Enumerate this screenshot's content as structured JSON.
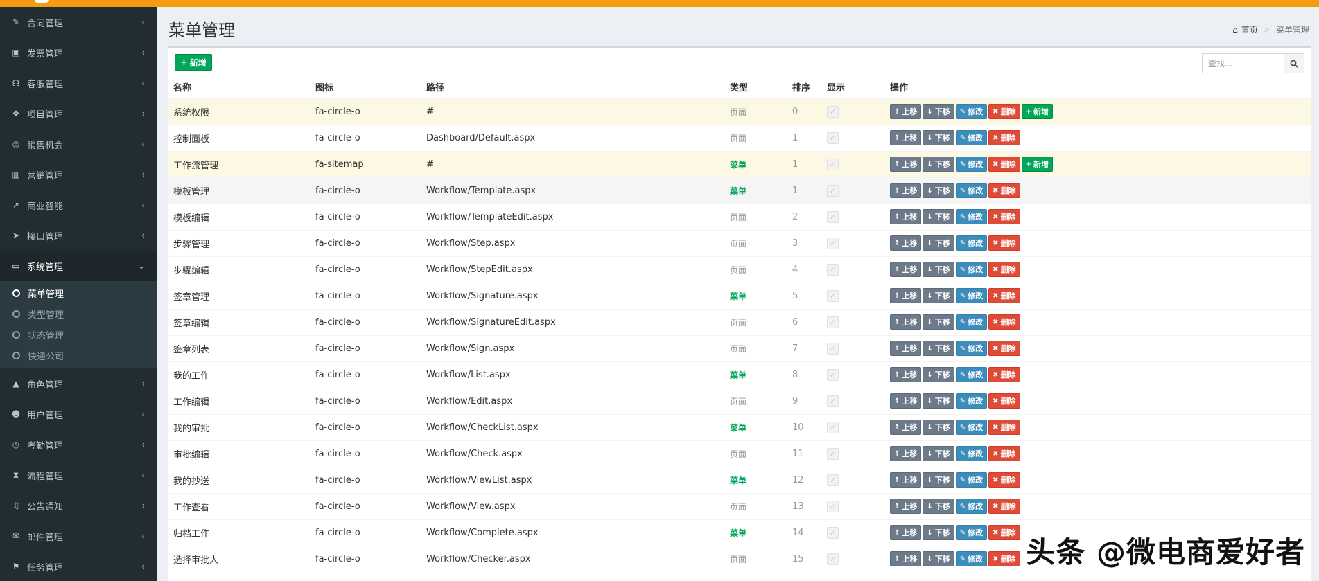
{
  "sidebar": {
    "items": [
      {
        "label": "合同管理",
        "icon": "pencil-icon"
      },
      {
        "label": "发票管理",
        "icon": "money-icon"
      },
      {
        "label": "客服管理",
        "icon": "headset-icon"
      },
      {
        "label": "项目管理",
        "icon": "cubes-icon"
      },
      {
        "label": "销售机会",
        "icon": "binoculars-icon"
      },
      {
        "label": "营销管理",
        "icon": "bar-chart-icon"
      },
      {
        "label": "商业智能",
        "icon": "line-chart-icon"
      },
      {
        "label": "接口管理",
        "icon": "paper-plane-icon"
      },
      {
        "label": "系统管理",
        "icon": "desktop-icon",
        "expanded": true
      },
      {
        "label": "角色管理",
        "icon": "graduation-cap-icon"
      },
      {
        "label": "用户管理",
        "icon": "users-icon"
      },
      {
        "label": "考勤管理",
        "icon": "clock-icon"
      },
      {
        "label": "流程管理",
        "icon": "hourglass-icon"
      },
      {
        "label": "公告通知",
        "icon": "bell-icon"
      },
      {
        "label": "邮件管理",
        "icon": "envelope-icon"
      },
      {
        "label": "任务管理",
        "icon": "flag-icon"
      }
    ],
    "submenu": [
      {
        "label": "菜单管理",
        "current": true
      },
      {
        "label": "类型管理"
      },
      {
        "label": "状态管理"
      },
      {
        "label": "快递公司"
      }
    ]
  },
  "header": {
    "title": "菜单管理",
    "breadcrumb_home": "首页",
    "breadcrumb_sep": ">",
    "breadcrumb_current": "菜单管理"
  },
  "toolbar": {
    "add_label": "新增",
    "search_placeholder": "查找..."
  },
  "table": {
    "columns": [
      "名称",
      "图标",
      "路径",
      "类型",
      "排序",
      "显示",
      "操作"
    ],
    "actions": {
      "up": "上移",
      "down": "下移",
      "edit": "修改",
      "delete": "删除",
      "add": "新增"
    },
    "rows": [
      {
        "name": "系统权限",
        "icon": "fa-circle-o",
        "path": "#",
        "type": "页面",
        "type_kind": "plain",
        "order": "0",
        "has_add": true,
        "style": "warning"
      },
      {
        "name": "控制面板",
        "icon": "fa-circle-o",
        "path": "Dashboard/Default.aspx",
        "type": "页面",
        "type_kind": "plain",
        "order": "1",
        "has_add": false,
        "style": ""
      },
      {
        "name": "工作流管理",
        "icon": "fa-sitemap",
        "path": "#",
        "type": "菜单",
        "type_kind": "menu",
        "order": "1",
        "has_add": true,
        "style": "warning"
      },
      {
        "name": "模板管理",
        "icon": "fa-circle-o",
        "path": "Workflow/Template.aspx",
        "type": "菜单",
        "type_kind": "menu",
        "order": "1",
        "has_add": false,
        "style": "hover"
      },
      {
        "name": "模板编辑",
        "icon": "fa-circle-o",
        "path": "Workflow/TemplateEdit.aspx",
        "type": "页面",
        "type_kind": "plain",
        "order": "2",
        "has_add": false,
        "style": ""
      },
      {
        "name": "步骤管理",
        "icon": "fa-circle-o",
        "path": "Workflow/Step.aspx",
        "type": "页面",
        "type_kind": "plain",
        "order": "3",
        "has_add": false,
        "style": ""
      },
      {
        "name": "步骤编辑",
        "icon": "fa-circle-o",
        "path": "Workflow/StepEdit.aspx",
        "type": "页面",
        "type_kind": "plain",
        "order": "4",
        "has_add": false,
        "style": ""
      },
      {
        "name": "签章管理",
        "icon": "fa-circle-o",
        "path": "Workflow/Signature.aspx",
        "type": "菜单",
        "type_kind": "menu",
        "order": "5",
        "has_add": false,
        "style": ""
      },
      {
        "name": "签章编辑",
        "icon": "fa-circle-o",
        "path": "Workflow/SignatureEdit.aspx",
        "type": "页面",
        "type_kind": "plain",
        "order": "6",
        "has_add": false,
        "style": ""
      },
      {
        "name": "签章列表",
        "icon": "fa-circle-o",
        "path": "Workflow/Sign.aspx",
        "type": "页面",
        "type_kind": "plain",
        "order": "7",
        "has_add": false,
        "style": ""
      },
      {
        "name": "我的工作",
        "icon": "fa-circle-o",
        "path": "Workflow/List.aspx",
        "type": "菜单",
        "type_kind": "menu",
        "order": "8",
        "has_add": false,
        "style": ""
      },
      {
        "name": "工作编辑",
        "icon": "fa-circle-o",
        "path": "Workflow/Edit.aspx",
        "type": "页面",
        "type_kind": "plain",
        "order": "9",
        "has_add": false,
        "style": ""
      },
      {
        "name": "我的审批",
        "icon": "fa-circle-o",
        "path": "Workflow/CheckList.aspx",
        "type": "菜单",
        "type_kind": "menu",
        "order": "10",
        "has_add": false,
        "style": ""
      },
      {
        "name": "审批编辑",
        "icon": "fa-circle-o",
        "path": "Workflow/Check.aspx",
        "type": "页面",
        "type_kind": "plain",
        "order": "11",
        "has_add": false,
        "style": ""
      },
      {
        "name": "我的抄送",
        "icon": "fa-circle-o",
        "path": "Workflow/ViewList.aspx",
        "type": "菜单",
        "type_kind": "menu",
        "order": "12",
        "has_add": false,
        "style": ""
      },
      {
        "name": "工作查看",
        "icon": "fa-circle-o",
        "path": "Workflow/View.aspx",
        "type": "页面",
        "type_kind": "plain",
        "order": "13",
        "has_add": false,
        "style": ""
      },
      {
        "name": "归档工作",
        "icon": "fa-circle-o",
        "path": "Workflow/Complete.aspx",
        "type": "菜单",
        "type_kind": "menu",
        "order": "14",
        "has_add": false,
        "style": ""
      },
      {
        "name": "选择审批人",
        "icon": "fa-circle-o",
        "path": "Workflow/Checker.aspx",
        "type": "页面",
        "type_kind": "plain",
        "order": "15",
        "has_add": false,
        "style": ""
      }
    ]
  },
  "watermark": "头条 @微电商爱好者",
  "colors": {
    "topbar": "#f39c12",
    "sidebar": "#222d32",
    "add_green": "#00a65a",
    "edit_blue": "#3c8dbc",
    "delete_red": "#dd4b39",
    "move_gray": "#6c7a89",
    "warning_row": "#fcf8e3"
  }
}
